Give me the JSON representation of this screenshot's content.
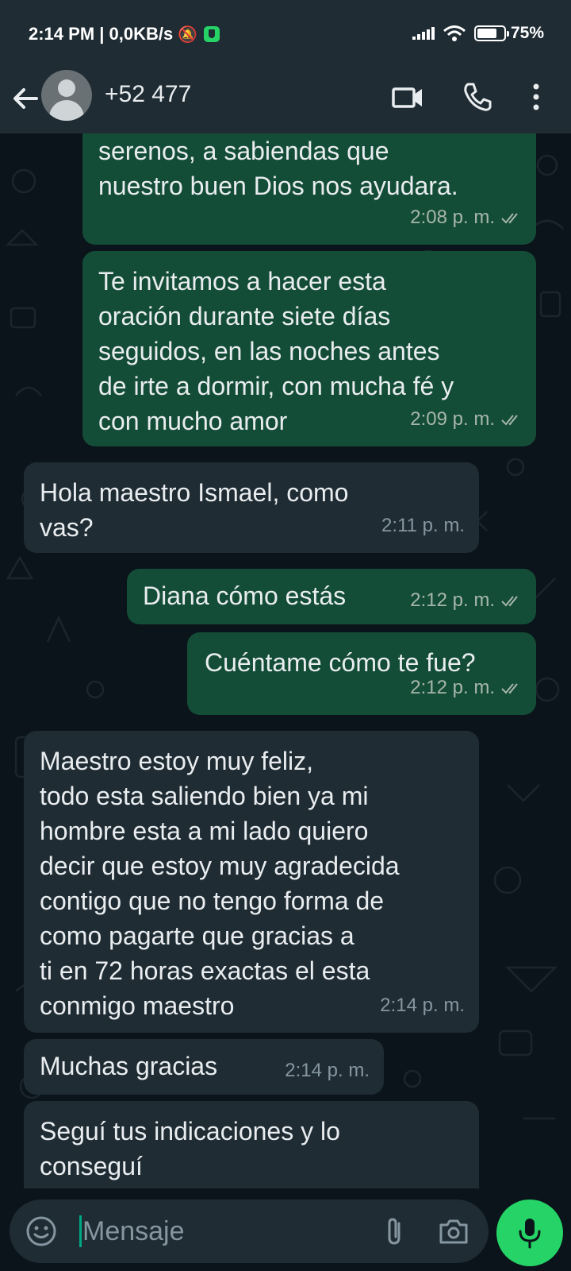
{
  "status_bar": {
    "time": "2:14 PM | 0,0KB/s",
    "battery": "75%",
    "battery_level": 0.75
  },
  "header": {
    "contact": "+52 477 ",
    "icons": [
      "back-arrow-icon",
      "avatar",
      "video-call-icon",
      "phone-icon",
      "more-options-icon"
    ]
  },
  "messages": [
    {
      "direction": "out",
      "text": "serenos, a sabiendas que\nnuestro buen Dios nos ayudara.",
      "time": "2:08 p. m.",
      "read": true
    },
    {
      "direction": "out",
      "text": "Te invitamos a hacer esta\noración durante siete días\nseguidos, en las noches antes\nde irte a dormir, con mucha fé y\ncon mucho amor",
      "time": "2:09 p. m.",
      "read": true
    },
    {
      "direction": "in",
      "text": "Hola maestro Ismael, como\nvas?",
      "time": "2:11 p. m."
    },
    {
      "direction": "out",
      "text": "Diana cómo estás",
      "time": "2:12 p. m.",
      "read": true
    },
    {
      "direction": "out",
      "text": "Cuéntame cómo te fue?",
      "time": "2:12 p. m.",
      "read": true
    },
    {
      "direction": "in",
      "text": "Maestro estoy muy feliz,\ntodo esta saliendo bien ya mi\nhombre esta a mi lado quiero\ndecir que estoy muy agradecida\ncontigo que no tengo forma de\ncomo pagarte que gracias a\nti en 72 horas exactas el esta\nconmigo maestro",
      "time": "2:14 p. m."
    },
    {
      "direction": "in",
      "text": "Muchas gracias",
      "time": "2:14 p. m."
    },
    {
      "direction": "in",
      "text": "Seguí tus indicaciones y lo\nconseguí",
      "time": ""
    }
  ],
  "input": {
    "placeholder": "Mensaje",
    "icons": [
      "emoji-icon",
      "attach-icon",
      "camera-icon",
      "mic-icon"
    ]
  },
  "colors": {
    "outgoing_bubble": "#144d37",
    "incoming_bubble": "#1f2c34",
    "background": "#0b141a",
    "accent": "#25d366"
  }
}
